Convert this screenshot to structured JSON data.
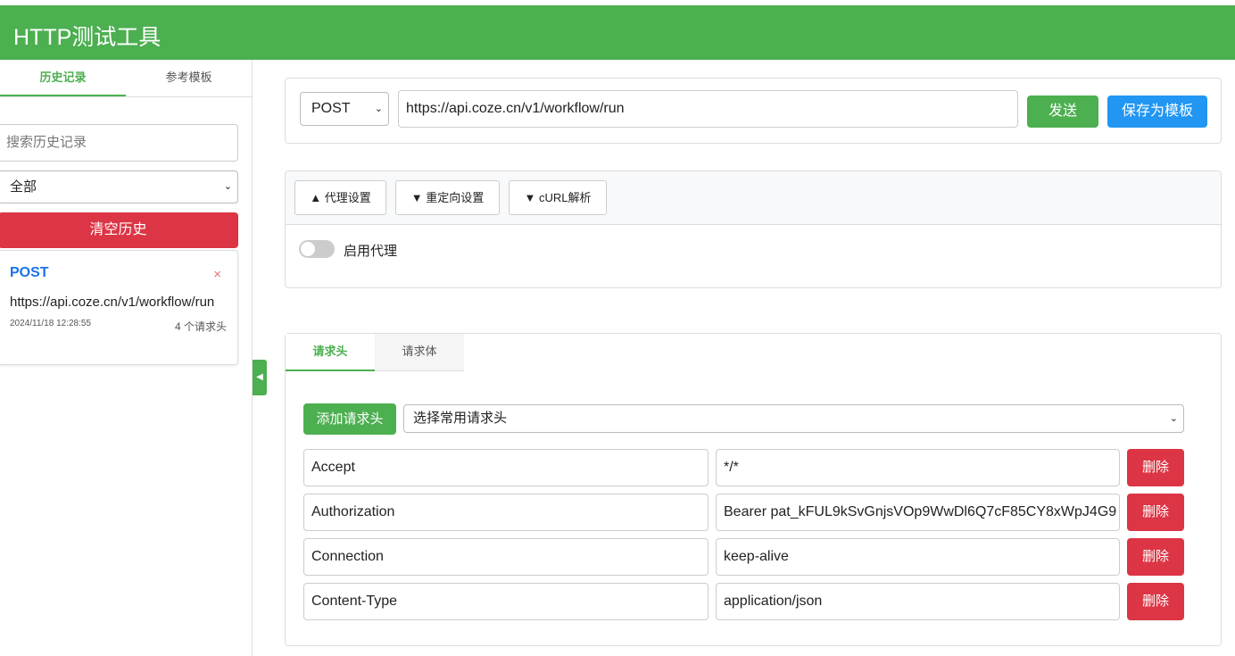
{
  "app": {
    "title": "HTTP测试工具"
  },
  "sidebar": {
    "tabs": [
      "历史记录",
      "参考模板"
    ],
    "search_placeholder": "搜索历史记录",
    "filter": "全部",
    "clear_label": "清空历史",
    "history": [
      {
        "method": "POST",
        "url": "https://api.coze.cn/v1/workflow/run",
        "time": "2024/11/18 12:28:55",
        "headers": "4 个请求头",
        "delete": "×"
      }
    ],
    "collapse_icon": "◀"
  },
  "request": {
    "method": "POST",
    "url": "https://api.coze.cn/v1/workflow/run",
    "send": "发送",
    "save": "保存为模板",
    "send_color": "#4caf50",
    "save_color": "#2196f3"
  },
  "options": {
    "tabs": [
      "▲ 代理设置",
      "▼ 重定向设置",
      "▼ cURL解析"
    ],
    "proxy_label": "启用代理",
    "proxy_enabled": false
  },
  "body_tabs": [
    "请求头",
    "请求体"
  ],
  "headers": {
    "add_label": "添加请求头",
    "common_select": "选择常用请求头",
    "delete_label": "删除",
    "rows": [
      {
        "key": "Accept",
        "value": "*/*"
      },
      {
        "key": "Authorization",
        "value": "Bearer pat_kFUL9kSvGnjsVOp9WwDl6Q7cF85CY8xWpJ4G9"
      },
      {
        "key": "Connection",
        "value": "keep-alive"
      },
      {
        "key": "Content-Type",
        "value": "application/json"
      }
    ]
  }
}
